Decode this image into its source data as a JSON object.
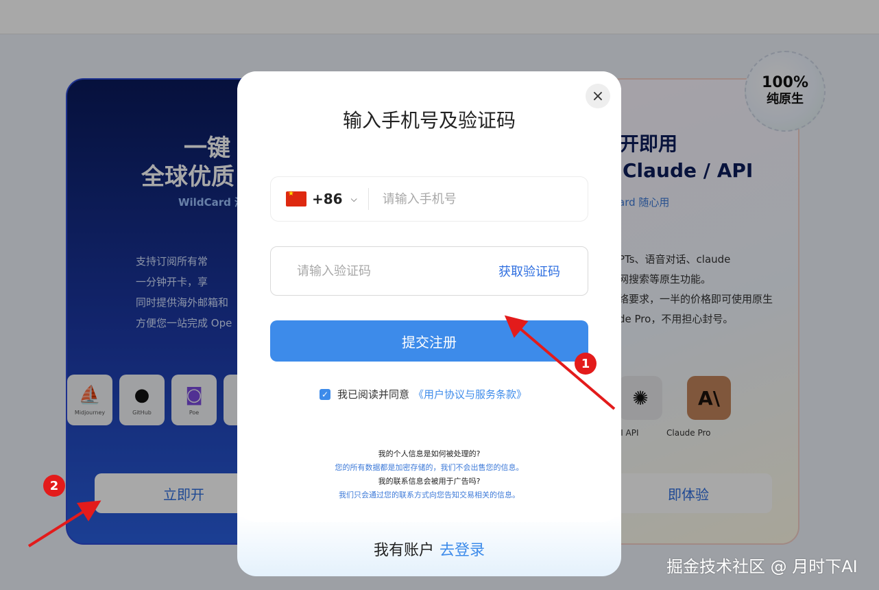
{
  "background_page": {
    "left_card": {
      "title_line1": "一键",
      "title_line2": "全球优质",
      "subtitle": "WildCard 海",
      "description": [
        "支持订阅所有常",
        "一分钟开卡，享",
        "同时提供海外邮箱和",
        "方便您一站完成 Ope"
      ],
      "apps": [
        {
          "label": "Midjourney",
          "icon": "sailboat-icon"
        },
        {
          "label": "GitHub",
          "icon": "github-icon"
        },
        {
          "label": "Poe",
          "icon": "poe-icon"
        }
      ],
      "cta": "立即开"
    },
    "right_card": {
      "title_line1": "开即用",
      "title_line2": "Claude / API",
      "subtitle": "ard 随心用",
      "description": [
        "PTs、语音对话、claude",
        "网搜索等原生功能。",
        "络要求，一半的价格即可使用原生",
        "de Pro，不用担心封号。"
      ],
      "apps": [
        {
          "label": "OpenAI API",
          "icon": "openai-icon",
          "badge": "API"
        },
        {
          "label": "Claude Pro",
          "icon": "claude-icon"
        }
      ],
      "app_labels": [
        "enAI API",
        "Claude Pro"
      ],
      "cta": "即体验"
    },
    "badge": {
      "line1": "100%",
      "line2": "纯原生"
    }
  },
  "modal": {
    "title": "输入手机号及验证码",
    "phone": {
      "country_code": "+86",
      "flag": "china-flag",
      "placeholder": "请输入手机号",
      "value": ""
    },
    "verification": {
      "placeholder": "请输入验证码",
      "value": "",
      "get_code_label": "获取验证码"
    },
    "submit_label": "提交注册",
    "agreement": {
      "checked": true,
      "text": "我已阅读并同意",
      "link": "《用户协议与服务条款》"
    },
    "faq": [
      {
        "q": "我的个人信息是如何被处理的?",
        "a": "您的所有数据都是加密存储的，我们不会出售您的信息。"
      },
      {
        "q": "我的联系信息会被用于广告吗?",
        "a": "我们只会通过您的联系方式向您告知交易相关的信息。"
      }
    ],
    "login": {
      "text": "我有账户",
      "link": "去登录"
    }
  },
  "annotations": {
    "marker1": "1",
    "marker2": "2",
    "color": "#e31b1b"
  },
  "watermark": "掘金技术社区 @ 月时下AI",
  "colors": {
    "accent": "#3d8bea",
    "overlay": "rgba(0,0,0,0.34)"
  }
}
